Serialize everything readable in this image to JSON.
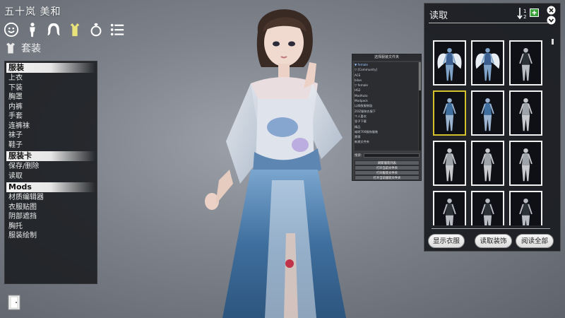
{
  "header": {
    "character_name": "五十岚 美和"
  },
  "category_icons": [
    "face-icon",
    "body-icon",
    "hair-icon",
    "clothing-icon",
    "accessory-icon",
    "list-icon"
  ],
  "section": {
    "label": "套装",
    "icon": "outfit-icon"
  },
  "menu": {
    "groups": [
      {
        "title": "服装",
        "items": [
          "上衣",
          "下装",
          "胸罩",
          "内裤",
          "手套",
          "连裤袜",
          "袜子",
          "鞋子"
        ]
      },
      {
        "title": "服装卡",
        "items": [
          "保存/删除",
          "读取"
        ]
      },
      {
        "title": "Mods",
        "items": [
          "材质编辑器",
          "衣服贴图",
          "阴部遮挡",
          "胸托",
          "服装绘制"
        ]
      }
    ]
  },
  "folder_window": {
    "title": "选择服装文件夹",
    "tree": [
      "▼ female",
      "   ▽ [Community]",
      "       ACE",
      "       bilan",
      "   ▽ female",
      "       HS2",
      "       ModAuto",
      "       Modpack",
      "       以商服服装链",
      "       ZOZ服装衣服下",
      "       个人喜欢",
      "       皇子下载",
      "       精品",
      "       喵呢700服饰服装",
      "       蔷薇",
      "       新建文件夹"
    ],
    "search_label": "搜索:",
    "search_value": "",
    "buttons": [
      "刷新服装列表",
      "打开当前文件夹",
      "打开服装文件夹",
      "打开当前服装文件夹"
    ]
  },
  "load_panel": {
    "title": "读取",
    "buttons": {
      "show_clothes": "显示衣服",
      "load_accessories": "读取装饰",
      "load_all": "阅读全部"
    },
    "thumbnails": [
      {
        "style": "wings",
        "selected": false
      },
      {
        "style": "wings",
        "selected": false
      },
      {
        "style": "dark",
        "selected": false
      },
      {
        "style": "blue",
        "selected": true
      },
      {
        "style": "blue",
        "selected": false
      },
      {
        "style": "plain",
        "selected": false
      },
      {
        "style": "plain",
        "selected": false
      },
      {
        "style": "plain",
        "selected": false
      },
      {
        "style": "plain",
        "selected": false
      },
      {
        "style": "dark",
        "selected": false
      },
      {
        "style": "dark",
        "selected": false
      },
      {
        "style": "dark",
        "selected": false
      }
    ]
  },
  "colors": {
    "accent_selected": "#d4c02a",
    "panel_bg": "#191b1f",
    "dress_blue": "#3f6f9e"
  }
}
